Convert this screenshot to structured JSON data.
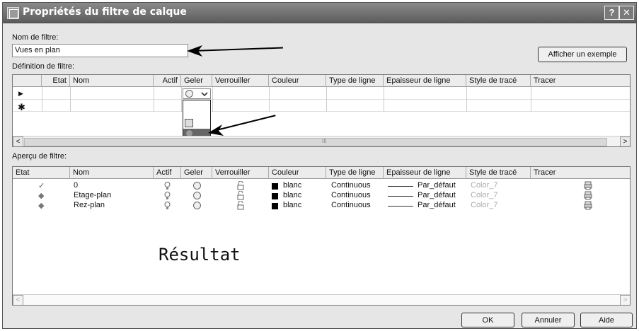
{
  "window": {
    "title": "Propriétés du filtre de calque",
    "help_label": "?",
    "close_label": "✕"
  },
  "filter_name": {
    "label": "Nom de filtre:",
    "value": "Vues en plan"
  },
  "show_example_label": "Afficher un exemple",
  "definition": {
    "label": "Définition de filtre:",
    "columns": [
      "Etat",
      "Nom",
      "Actif",
      "Geler",
      "Verrouiller",
      "Couleur",
      "Type de ligne",
      "Epaisseur de ligne",
      "Style de tracé",
      "Tracer"
    ],
    "current_row_marker": "▶",
    "new_row_marker": "✱",
    "scroll_thumb": "III"
  },
  "preview": {
    "label": "Aperçu de filtre:",
    "columns": [
      "Etat",
      "Nom",
      "Actif",
      "Geler",
      "Verrouiller",
      "Couleur",
      "Type de ligne",
      "Epaisseur de ligne",
      "Style de tracé",
      "Tracer"
    ],
    "rows": [
      {
        "etat": "✓",
        "nom": "0",
        "couleur": "blanc",
        "type_ligne": "Continuous",
        "epaisseur": "Par_défaut",
        "style": "Color_7"
      },
      {
        "etat": "◆",
        "nom": "Etage-plan",
        "couleur": "blanc",
        "type_ligne": "Continuous",
        "epaisseur": "Par_défaut",
        "style": "Color_7"
      },
      {
        "etat": "◆",
        "nom": "Rez-plan",
        "couleur": "blanc",
        "type_ligne": "Continuous",
        "epaisseur": "Par_défaut",
        "style": "Color_7"
      }
    ],
    "result_text": "Résultat"
  },
  "buttons": {
    "ok": "OK",
    "cancel": "Annuler",
    "help": "Aide"
  },
  "scroll_arrows": {
    "left": "<",
    "right": ">"
  }
}
